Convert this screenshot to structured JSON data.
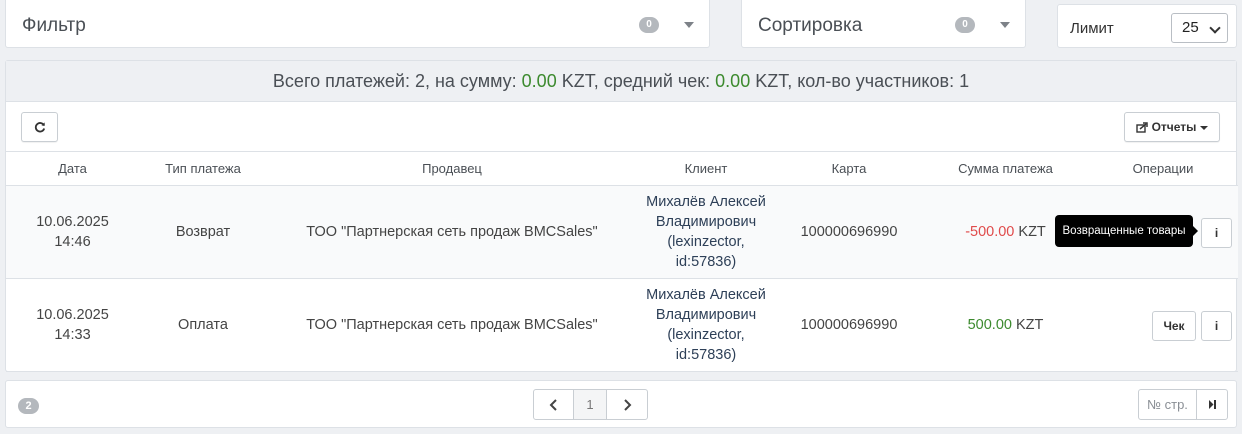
{
  "filter": {
    "title": "Фильтр",
    "count": "0"
  },
  "sort": {
    "title": "Сортировка",
    "count": "0"
  },
  "limit": {
    "label": "Лимит",
    "value": "25"
  },
  "summary": {
    "prefix": "Всего платежей: 2, на сумму: ",
    "total_amount": "0.00",
    "mid1": " KZT, средний чек: ",
    "avg_check": "0.00",
    "mid2": " KZT, кол-во участников: 1"
  },
  "toolbar": {
    "reports_label": "Отчеты"
  },
  "table": {
    "headers": [
      "Дата",
      "Тип платежа",
      "Продавец",
      "Клиент",
      "Карта",
      "Сумма платежа",
      "Операции"
    ],
    "rows": [
      {
        "date": "10.06.2025",
        "time": "14:46",
        "type": "Возврат",
        "seller": "ТОО \"Партнерская сеть продаж BMCSales\"",
        "client_l1": "Михалёв Алексей",
        "client_l2": "Владимирович",
        "client_l3": "(lexinzector,",
        "client_l4": "id:57836)",
        "card": "100000696990",
        "amount": "-500.00",
        "currency": "KZT",
        "check_label": "",
        "tooltip": "Возвращенные товары"
      },
      {
        "date": "10.06.2025",
        "time": "14:33",
        "type": "Оплата",
        "seller": "ТОО \"Партнерская сеть продаж BMCSales\"",
        "client_l1": "Михалёв Алексей",
        "client_l2": "Владимирович",
        "client_l3": "(lexinzector,",
        "client_l4": "id:57836)",
        "card": "100000696990",
        "amount": "500.00",
        "currency": "KZT",
        "check_label": "Чек"
      }
    ]
  },
  "footer": {
    "total": "2",
    "current_page": "1",
    "page_jump_label": "№ стр."
  },
  "colors": {
    "positive": "#3c8a2e",
    "negative": "#e04b4b",
    "badge": "#b4b8bd"
  }
}
